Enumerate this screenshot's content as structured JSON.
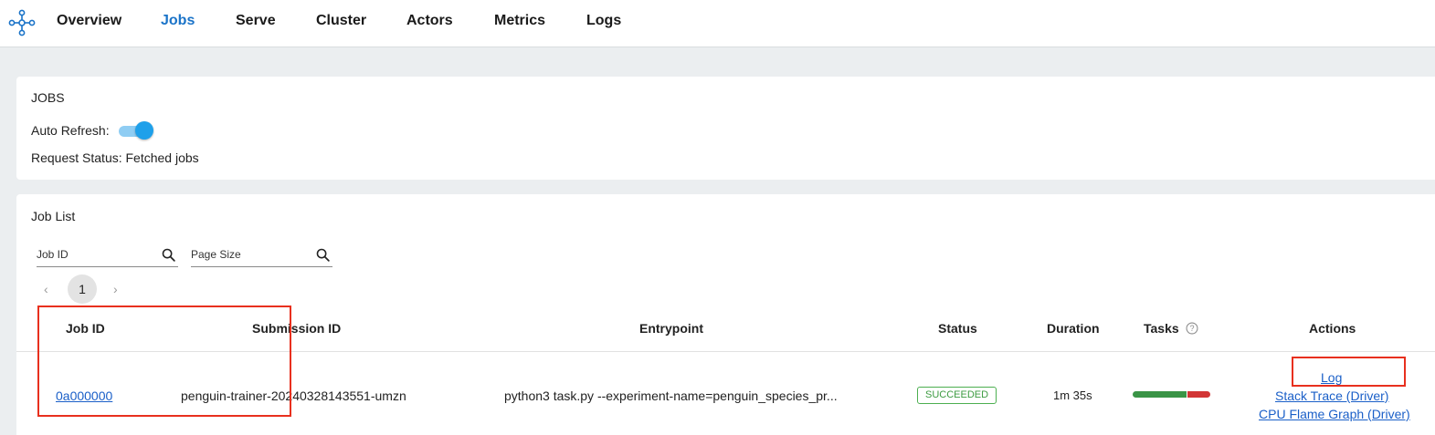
{
  "nav": {
    "logo_icon": "ray-logo-icon",
    "items": [
      {
        "label": "Overview",
        "active": false
      },
      {
        "label": "Jobs",
        "active": true
      },
      {
        "label": "Serve",
        "active": false
      },
      {
        "label": "Cluster",
        "active": false
      },
      {
        "label": "Actors",
        "active": false
      },
      {
        "label": "Metrics",
        "active": false
      },
      {
        "label": "Logs",
        "active": false
      }
    ]
  },
  "jobs_card": {
    "title": "JOBS",
    "auto_refresh_label": "Auto Refresh:",
    "auto_refresh_on": true,
    "request_status": "Request Status: Fetched jobs"
  },
  "job_list": {
    "title": "Job List",
    "search_job_id_placeholder": "Job ID",
    "search_page_size_placeholder": "Page Size",
    "pagination": {
      "prev": "‹",
      "current_page": "1",
      "next": "›"
    },
    "columns": [
      "Job ID",
      "Submission ID",
      "Entrypoint",
      "Status",
      "Duration",
      "Tasks",
      "Actions"
    ],
    "rows": [
      {
        "job_id": "0a000000",
        "submission_id": "penguin-trainer-20240328143551-umzn",
        "entrypoint": "python3 task.py --experiment-name=penguin_species_pr...",
        "status": "SUCCEEDED",
        "duration": "1m 35s",
        "tasks_succeeded_fraction": 0.69,
        "tasks_failed_fraction": 0.31,
        "actions": [
          "Log",
          "Stack Trace (Driver)",
          "CPU Flame Graph (Driver)"
        ]
      }
    ]
  },
  "colors": {
    "accent": "#1a73c8",
    "link": "#1a5fc8",
    "success": "#3a9446",
    "failed": "#d23535",
    "highlight": "#e8301e"
  }
}
